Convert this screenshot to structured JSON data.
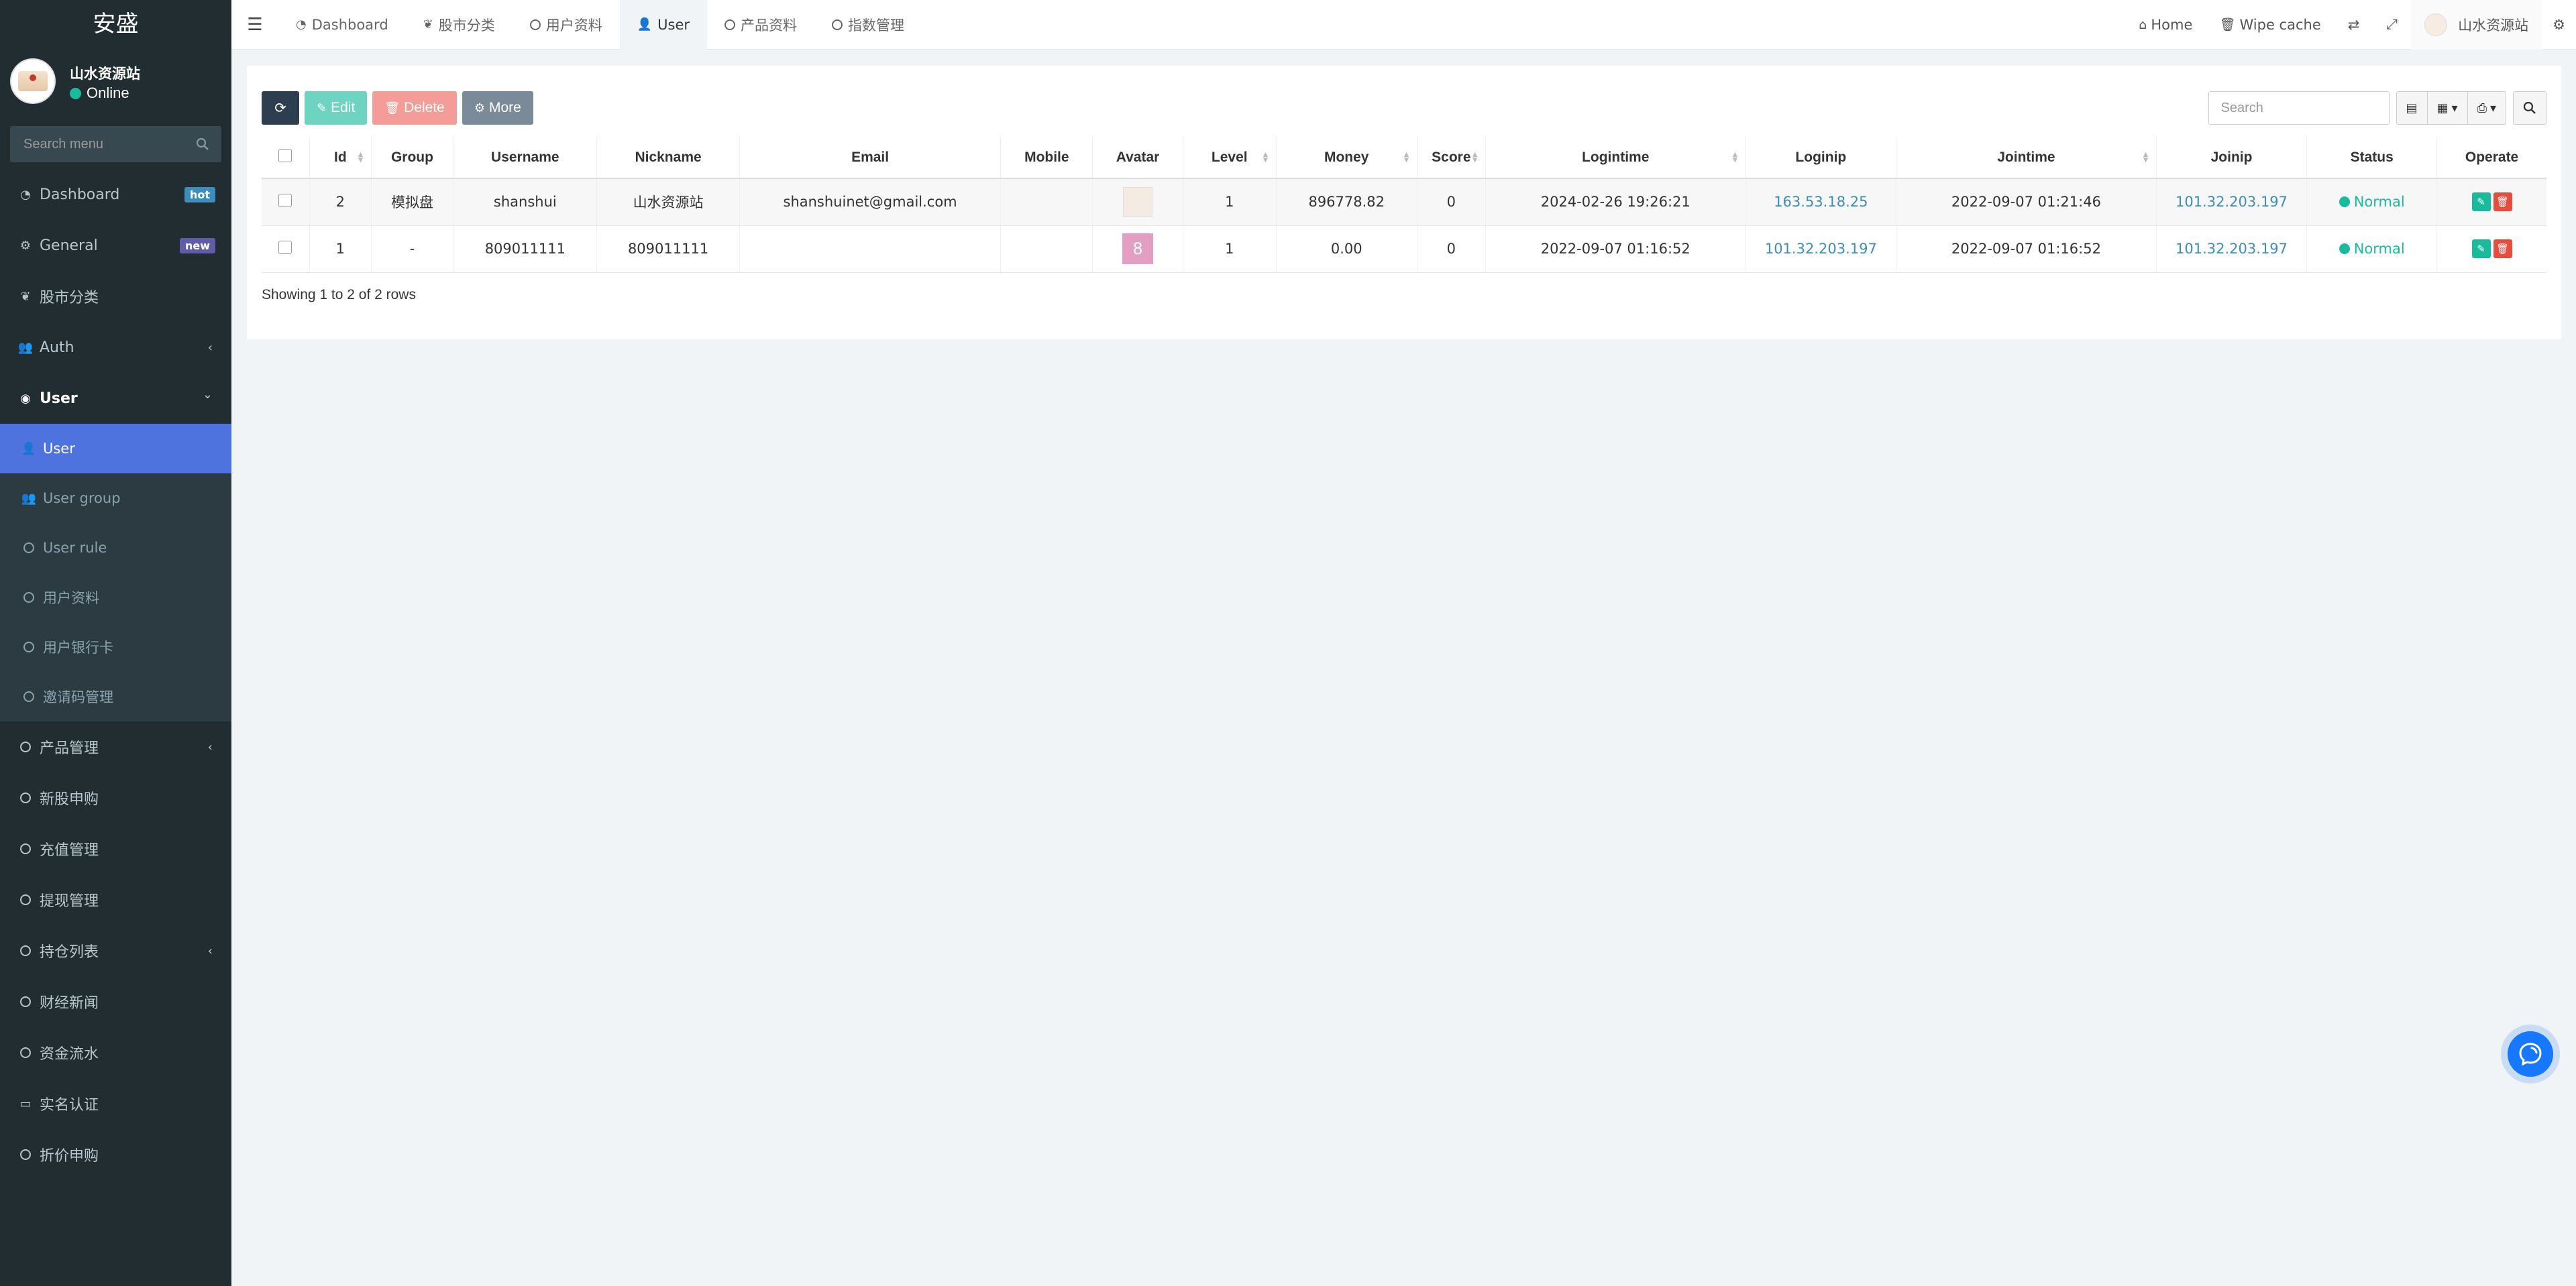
{
  "brand": "安盛",
  "user_panel": {
    "name": "山水资源站",
    "status": "Online"
  },
  "sidebar_search": {
    "placeholder": "Search menu"
  },
  "menu": [
    {
      "label": "Dashboard",
      "icon": "dashboard-icon",
      "badge": "hot",
      "badge_color": "#3c8dbc"
    },
    {
      "label": "General",
      "icon": "cogs-icon",
      "badge": "new",
      "badge_color": "#605ca8"
    },
    {
      "label": "股市分类",
      "icon": "leaf-icon"
    },
    {
      "label": "Auth",
      "icon": "group-icon",
      "chevron": "‹"
    },
    {
      "label": "User",
      "icon": "user-circle-icon",
      "chevron": "⌄"
    }
  ],
  "user_submenu": [
    {
      "label": "User",
      "icon": "user-icon",
      "active": true
    },
    {
      "label": "User group",
      "icon": "group-icon"
    },
    {
      "label": "User rule",
      "icon": "circle-icon"
    },
    {
      "label": "用户资料",
      "icon": "circle-icon"
    },
    {
      "label": "用户银行卡",
      "icon": "circle-icon"
    },
    {
      "label": "邀请码管理",
      "icon": "circle-icon"
    }
  ],
  "menu_bottom": [
    {
      "label": "产品管理",
      "icon": "circle-icon",
      "chevron": "‹"
    },
    {
      "label": "新股申购",
      "icon": "circle-icon"
    },
    {
      "label": "充值管理",
      "icon": "circle-icon"
    },
    {
      "label": "提现管理",
      "icon": "circle-icon"
    },
    {
      "label": "持仓列表",
      "icon": "circle-icon",
      "chevron": "‹"
    },
    {
      "label": "财经新闻",
      "icon": "circle-icon"
    },
    {
      "label": "资金流水",
      "icon": "circle-icon"
    },
    {
      "label": "实名认证",
      "icon": "credit-card-icon"
    },
    {
      "label": "折价申购",
      "icon": "circle-icon"
    }
  ],
  "nav_tabs": [
    {
      "label": "Dashboard",
      "icon": "dashboard-icon"
    },
    {
      "label": "股市分类",
      "icon": "leaf-icon"
    },
    {
      "label": "用户资料",
      "icon": "circle-icon"
    },
    {
      "label": "User",
      "icon": "user-icon",
      "active": true
    },
    {
      "label": "产品资料",
      "icon": "circle-icon"
    },
    {
      "label": "指数管理",
      "icon": "circle-icon"
    }
  ],
  "nav_right": {
    "home": "Home",
    "wipe": "Wipe cache",
    "user": "山水资源站"
  },
  "toolbar": {
    "edit": "Edit",
    "delete": "Delete",
    "more": "More"
  },
  "search": {
    "placeholder": "Search"
  },
  "table": {
    "columns": [
      "Id",
      "Group",
      "Username",
      "Nickname",
      "Email",
      "Mobile",
      "Avatar",
      "Level",
      "Money",
      "Score",
      "Logintime",
      "Loginip",
      "Jointime",
      "Joinip",
      "Status",
      "Operate"
    ],
    "rows": [
      {
        "id": "2",
        "group": "模拟盘",
        "username": "shanshui",
        "nickname": "山水资源站",
        "email": "shanshuinet@gmail.com",
        "mobile": "",
        "avatar": "",
        "level": "1",
        "money": "896778.82",
        "score": "0",
        "logintime": "2024-02-26 19:26:21",
        "loginip": "163.53.18.25",
        "jointime": "2022-09-07 01:21:46",
        "joinip": "101.32.203.197",
        "status": "Normal"
      },
      {
        "id": "1",
        "group": "-",
        "username": "809011111",
        "nickname": "809011111",
        "email": "",
        "mobile": "",
        "avatar": "8",
        "level": "1",
        "money": "0.00",
        "score": "0",
        "logintime": "2022-09-07 01:16:52",
        "loginip": "101.32.203.197",
        "jointime": "2022-09-07 01:16:52",
        "joinip": "101.32.203.197",
        "status": "Normal"
      }
    ]
  },
  "pagination": "Showing 1 to 2 of 2 rows",
  "colors": {
    "sidebar_bg": "#222d32",
    "active_menu": "#4e73df",
    "status_green": "#18bc9c",
    "link_blue": "#3c8dbc"
  }
}
